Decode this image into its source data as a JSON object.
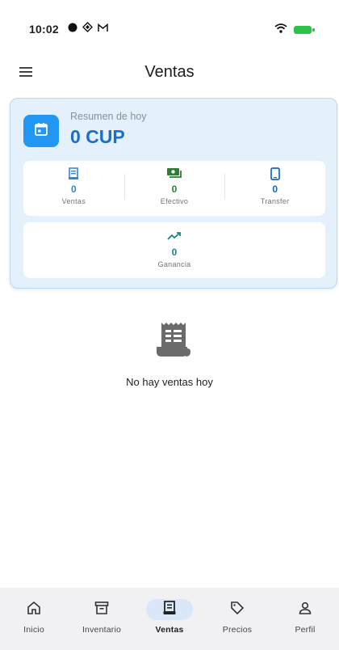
{
  "status_bar": {
    "time": "10:02",
    "icons": [
      "record-icon",
      "cast-icon",
      "gmail-icon"
    ],
    "right_icons": [
      "wifi-icon",
      "battery-icon"
    ]
  },
  "app_bar": {
    "title": "Ventas",
    "menu_icon": "hamburger-menu-icon"
  },
  "summary": {
    "label": "Resumen de hoy",
    "amount": "0 CUP",
    "icon": "calendar-icon",
    "stats": [
      {
        "value": "0",
        "label": "Ventas",
        "icon": "receipt-icon",
        "color": "#2f86d6"
      },
      {
        "value": "0",
        "label": "Efectivo",
        "icon": "cash-icon",
        "color": "#2e7d32"
      },
      {
        "value": "0",
        "label": "Transfer",
        "icon": "phone-icon",
        "color": "#1565c0"
      }
    ],
    "profit": {
      "value": "0",
      "label": "Ganancia",
      "icon": "trending-up-icon",
      "color": "#16878a"
    }
  },
  "empty_state": {
    "icon": "receipt-long-icon",
    "message": "No hay ventas hoy"
  },
  "bottom_nav": {
    "items": [
      {
        "label": "Inicio",
        "icon": "home-icon",
        "active": false
      },
      {
        "label": "Inventario",
        "icon": "archive-icon",
        "active": false
      },
      {
        "label": "Ventas",
        "icon": "receipt-icon",
        "active": true
      },
      {
        "label": "Precios",
        "icon": "tag-icon",
        "active": false
      },
      {
        "label": "Perfil",
        "icon": "person-icon",
        "active": false
      }
    ]
  },
  "colors": {
    "accent": "#2196f3",
    "card_bg": "#e4f1fc",
    "amount": "#1a6fc7",
    "nav_active_bg": "#d9e7f8",
    "battery": "#2ec24a"
  }
}
